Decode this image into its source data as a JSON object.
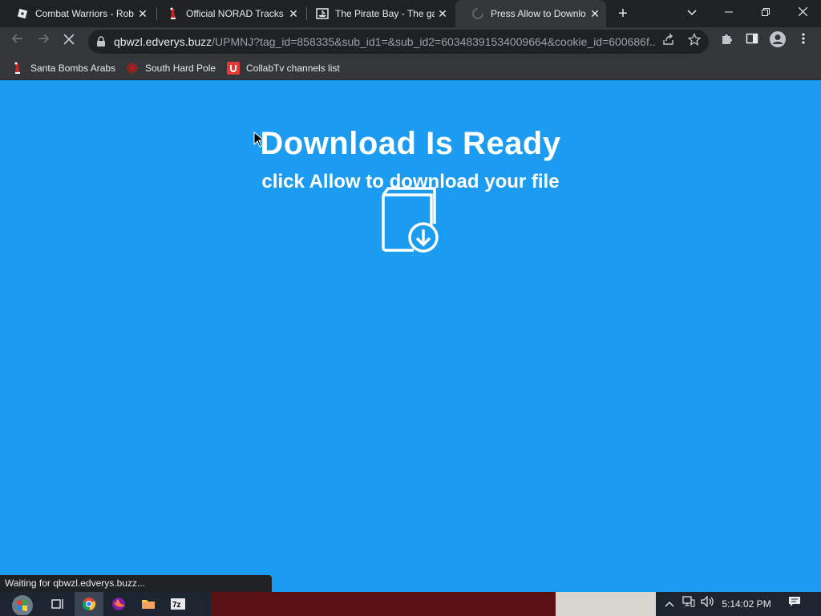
{
  "tabs": [
    {
      "title": "Combat Warriors - Rob",
      "favicon": "roblox-icon"
    },
    {
      "title": "Official NORAD Tracks",
      "favicon": "santa-icon"
    },
    {
      "title": "The Pirate Bay - The ga",
      "favicon": "pirate-ship-icon"
    },
    {
      "title": "Press Allow to Downlo",
      "favicon": "loading-spinner-icon",
      "active": true
    }
  ],
  "address_bar": {
    "host": "qbwzl.edverys.buzz",
    "path": "/UPMNJ?tag_id=858335&sub_id1=&sub_id2=60348391534009664&cookie_id=600686f..."
  },
  "bookmarks": [
    {
      "label": "Santa Bombs Arabs",
      "icon": "santa-icon"
    },
    {
      "label": "South Hard Pole",
      "icon": "snowflake-icon"
    },
    {
      "label": "CollabTv channels list",
      "icon": "collabtv-icon"
    }
  ],
  "page": {
    "headline": "Download Is Ready",
    "subline": "click Allow to download your file"
  },
  "status_text": "Waiting for qbwzl.edverys.buzz...",
  "taskbar": {
    "clock": "5:14:02 PM"
  },
  "colors": {
    "page_background": "#1c9cf0",
    "browser_frame": "#202124",
    "toolbar": "#35363a"
  }
}
